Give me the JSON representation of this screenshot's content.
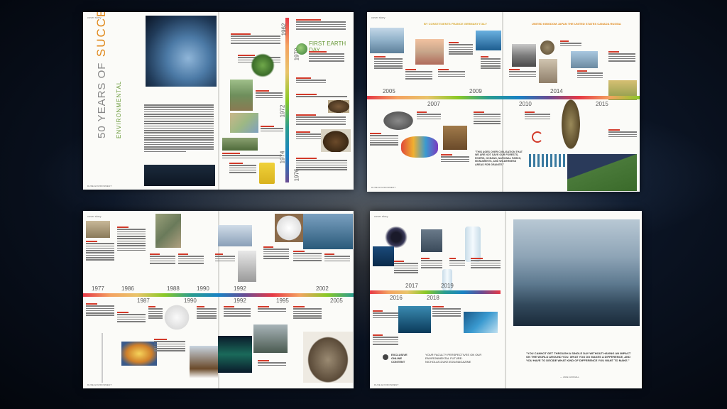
{
  "spread1": {
    "section": "cover story",
    "title_years": "50 YEARS OF",
    "title_word": "SUCCESSES",
    "title_sub": "ENVIRONMENTAL",
    "footer": "DUKE ENVIRONMENT",
    "earth_day": "FIRST EARTH DAY",
    "decades": [
      "1962",
      "1970",
      "1972",
      "1974",
      "1976"
    ]
  },
  "spread2": {
    "section": "cover story",
    "countries_a": "BY CONSTITUENTS  FRANCE GERMANY ITALY",
    "countries_b": "UNITED KINGDOM JAPAN THE UNITED STATES CANADA RUSSIA",
    "years_top": [
      "2005",
      "2009",
      "2014"
    ],
    "years_bottom": [
      "2007",
      "2010",
      "2015"
    ],
    "quote": "\"THIS AGES OVER CIVILISATION THAT WE ARE NOT SAVE OUR FORESTS, RIVERS, OCEANS, NATIONAL PARKS, MONUMENTS, AND WILDERNESS AREAS FOR GRANITE.\"",
    "footer": "DUKE ENVIRONMENT"
  },
  "spread3": {
    "section": "cover story",
    "years_top": [
      "1977",
      "1986",
      "1988",
      "1990",
      "1992",
      "1995",
      "2002"
    ],
    "years_bottom": [
      "1987",
      "1990",
      "1992",
      "1995",
      "2005"
    ],
    "footer": "DUKE ENVIRONMENT"
  },
  "spread4": {
    "section": "cover story",
    "years_top": [
      "2017",
      "2019"
    ],
    "years_bottom": [
      "2016",
      "2018"
    ],
    "exclusive_label": "EXCLUSIVE ONLINE CONTENT",
    "exclusive_text": "YOUR FACULTY PERSPECTIVES ON OUR ENVIRONMENTAL FUTURE: NICHOLAS.DUKE.EDU/MAGAZINE",
    "quote": "\"YOU CANNOT GET THROUGH A SINGLE DAY WITHOUT HAVING AN IMPACT ON THE WORLD AROUND YOU. WHAT YOU DO MAKES A DIFFERENCE, AND YOU HAVE TO DECIDE WHAT KIND OF DIFFERENCE YOU WANT TO MAKE.\"",
    "quote_author": "— JANE GOODALL",
    "footer": "DUKE ENVIRONMENT"
  },
  "colors": {
    "rainbow": [
      "#e63946",
      "#f4a261",
      "#e9c46a",
      "#8ac926",
      "#2a9d8f",
      "#1982c4",
      "#6a4c93",
      "#c03cbf"
    ],
    "accent_green": "#4caf50",
    "accent_red": "#d23a2a",
    "accent_orange": "#e08a1e"
  }
}
